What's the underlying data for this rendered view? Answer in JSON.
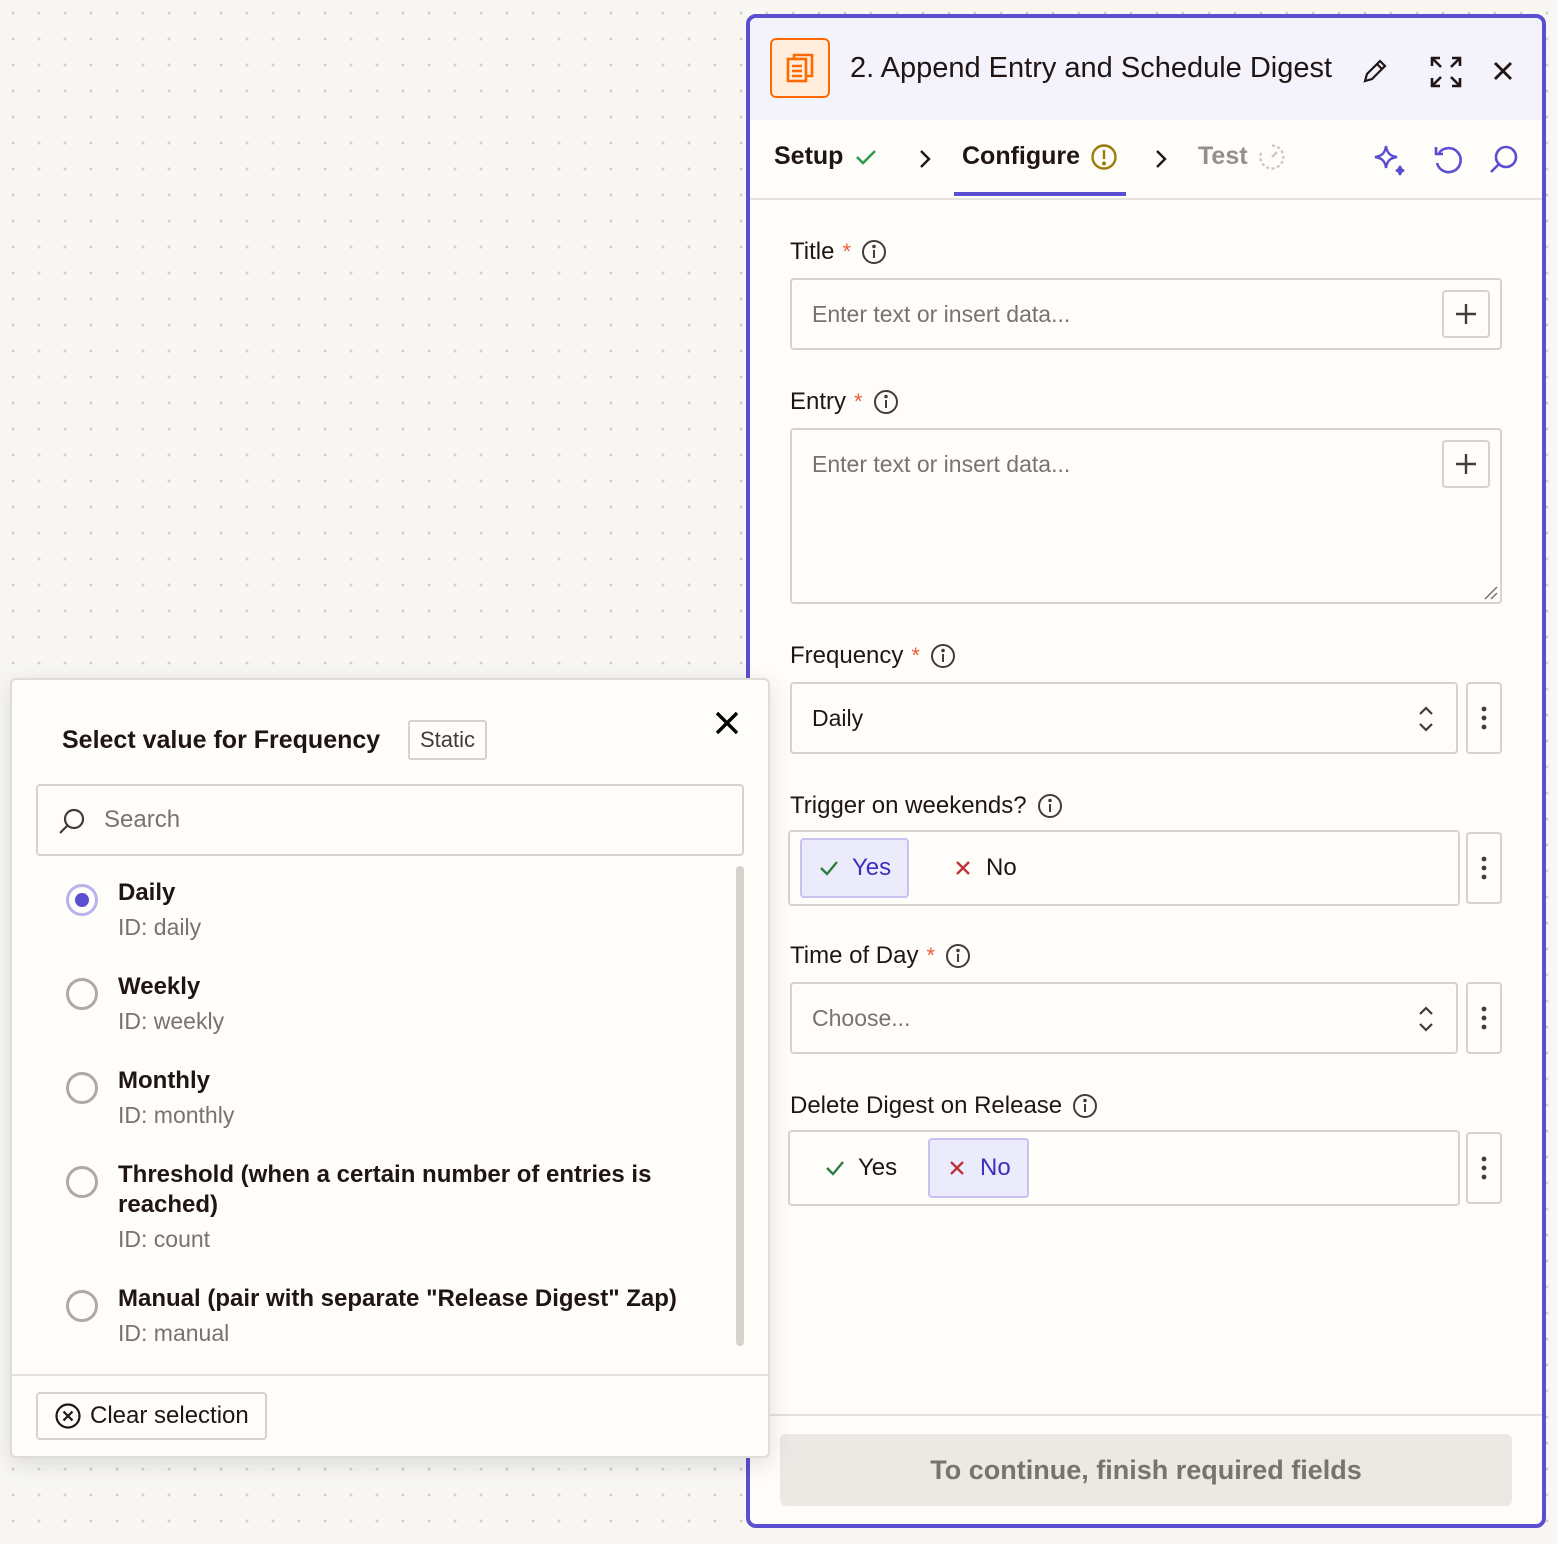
{
  "panel": {
    "step_title": "2. Append Entry and Schedule Digest",
    "app_icon": "digest-icon",
    "accent_color": "#5b4fd1",
    "tabs": [
      {
        "label": "Setup",
        "status": "complete"
      },
      {
        "label": "Configure",
        "status": "warning"
      },
      {
        "label": "Test",
        "status": "pending"
      }
    ],
    "fields": {
      "title": {
        "label": "Title",
        "required": "*",
        "placeholder": "Enter text or insert data..."
      },
      "entry": {
        "label": "Entry",
        "required": "*",
        "placeholder": "Enter text or insert data..."
      },
      "frequency": {
        "label": "Frequency",
        "required": "*",
        "value": "Daily"
      },
      "weekends": {
        "label": "Trigger on weekends?",
        "yes": "Yes",
        "no": "No",
        "selected": "Yes"
      },
      "time_of_day": {
        "label": "Time of Day",
        "required": "*",
        "placeholder": "Choose..."
      },
      "delete_digest": {
        "label": "Delete Digest on Release",
        "yes": "Yes",
        "no": "No",
        "selected": "No"
      }
    },
    "continue_label": "To continue, finish required fields"
  },
  "popover": {
    "title": "Select value for Frequency",
    "badge": "Static",
    "search_placeholder": "Search",
    "options": [
      {
        "label": "Daily",
        "id": "ID: daily",
        "selected": true
      },
      {
        "label": "Weekly",
        "id": "ID: weekly",
        "selected": false
      },
      {
        "label": "Monthly",
        "id": "ID: monthly",
        "selected": false
      },
      {
        "label": "Threshold (when a certain number of entries is reached)",
        "id": "ID: count",
        "selected": false
      },
      {
        "label": "Manual (pair with separate \"Release Digest\" Zap)",
        "id": "ID: manual",
        "selected": false
      }
    ],
    "clear_label": "Clear selection"
  }
}
